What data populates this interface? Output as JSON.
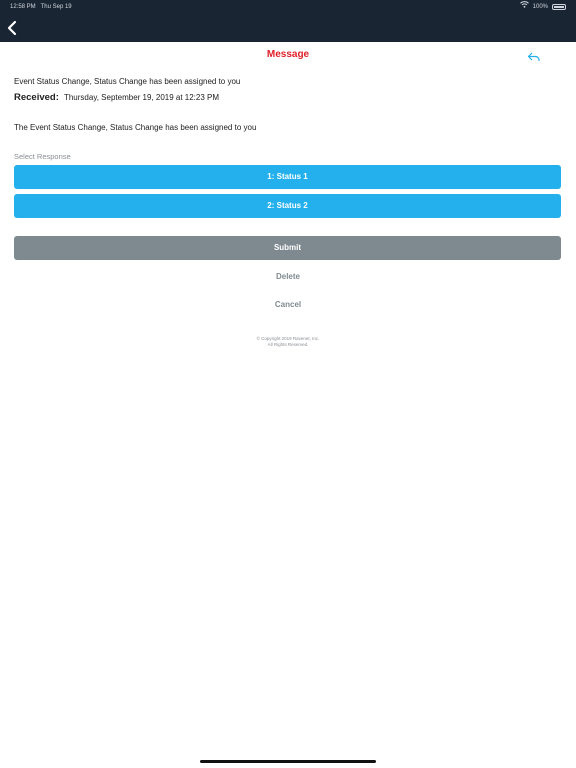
{
  "status_bar": {
    "time": "12:58 PM",
    "date": "Thu Sep 19",
    "battery": "100%"
  },
  "sheet": {
    "title": "Message"
  },
  "message": {
    "subject": "Event Status Change, Status Change has been assigned to you",
    "received_label": "Received:",
    "received_value": "Thursday, September 19, 2019 at 12:23 PM",
    "body": "The Event Status Change, Status Change has been assigned to you"
  },
  "response": {
    "label": "Select Response",
    "options": [
      {
        "label": "1: Status 1"
      },
      {
        "label": "2: Status 2"
      }
    ]
  },
  "actions": {
    "submit": "Submit",
    "delete": "Delete",
    "cancel": "Cancel"
  },
  "footer": {
    "copyright": "© Copyright 2019 Rave­net, Inc.",
    "rights": "All Rights Reserved."
  },
  "colors": {
    "header_bg": "#1a2533",
    "title": "#e0202a",
    "option_bg": "#23b0ed",
    "submit_bg": "#7f8a90",
    "muted_text": "#8a8f95"
  },
  "icons": {
    "back": "chevron-left-icon",
    "reply": "reply-icon",
    "wifi": "wifi-icon",
    "battery": "battery-icon"
  }
}
